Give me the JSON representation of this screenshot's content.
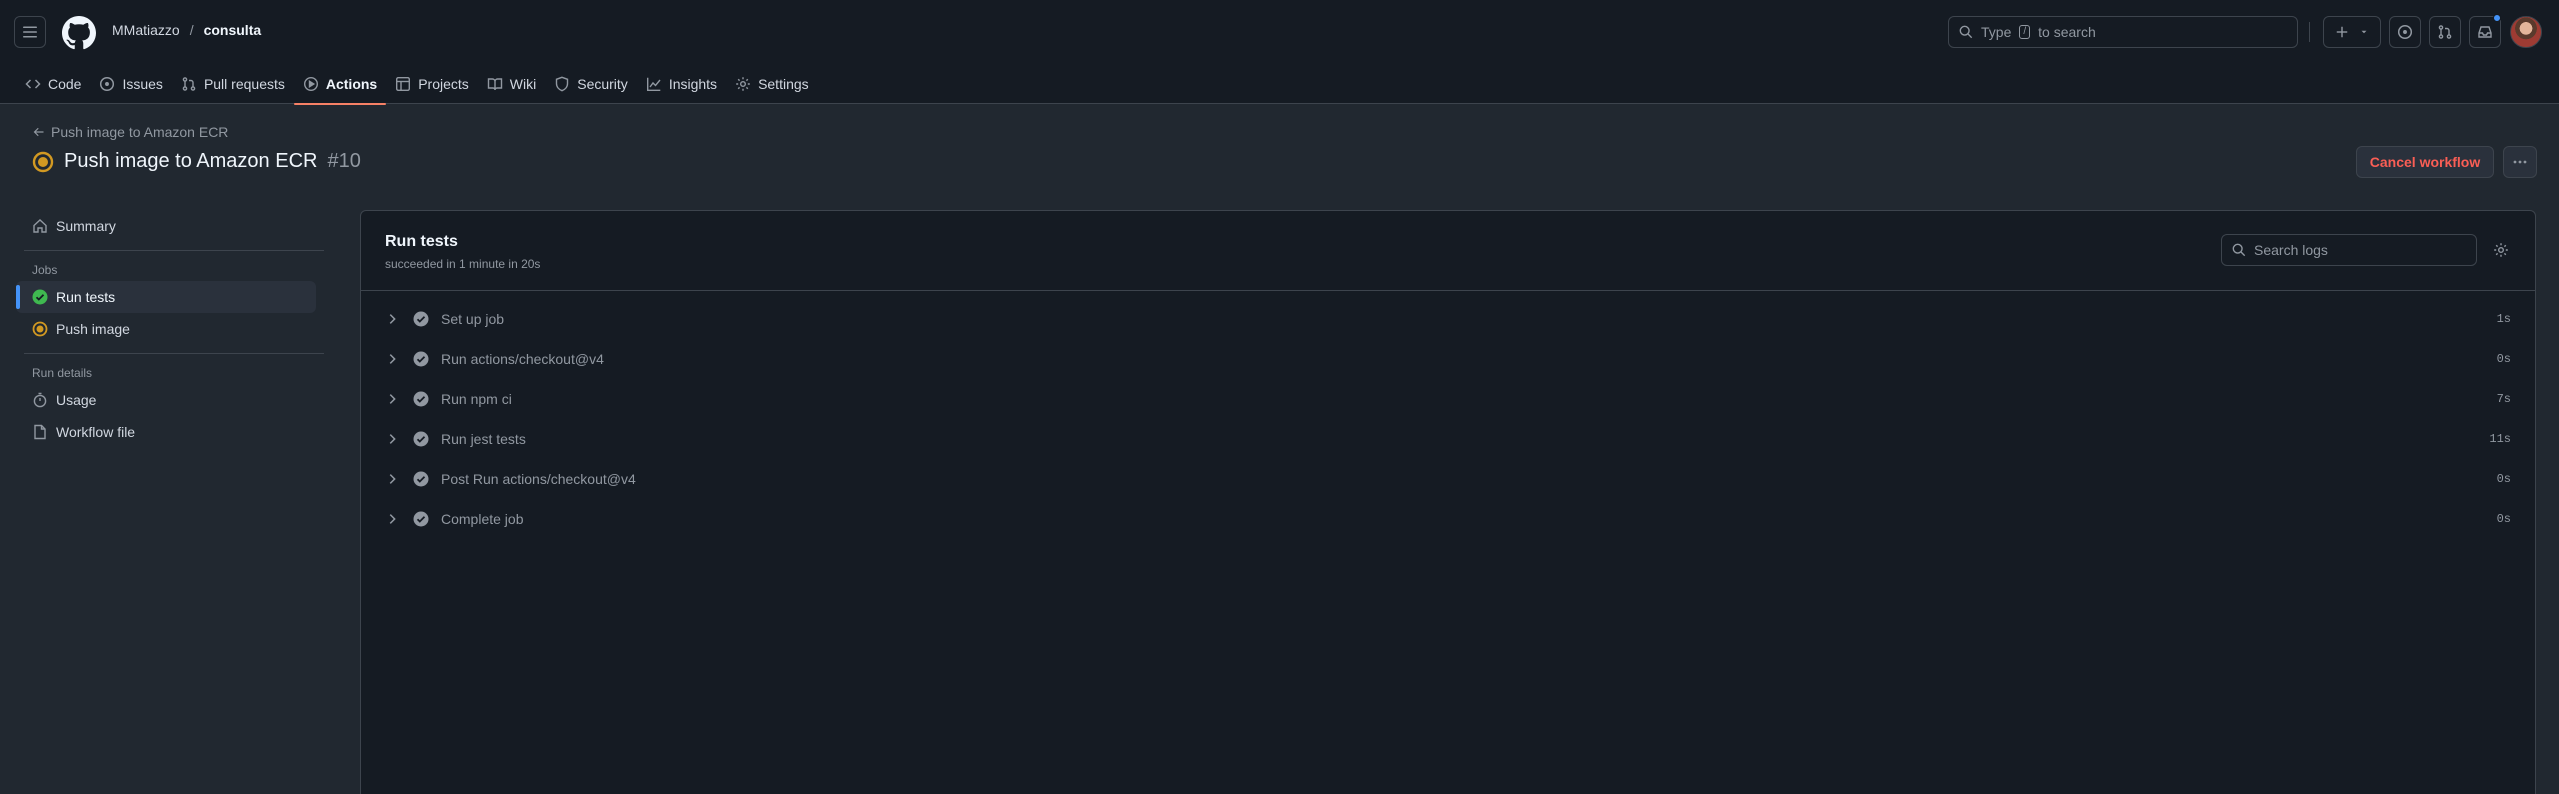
{
  "header": {
    "owner": "MMatiazzo",
    "separator": "/",
    "repo": "consulta",
    "search_prefix": "Type",
    "search_key": "/",
    "search_suffix": "to search"
  },
  "tabs": [
    {
      "label": "Code",
      "icon": "code-icon"
    },
    {
      "label": "Issues",
      "icon": "issue-opened-icon"
    },
    {
      "label": "Pull requests",
      "icon": "git-pull-request-icon"
    },
    {
      "label": "Actions",
      "icon": "play-icon",
      "active": true
    },
    {
      "label": "Projects",
      "icon": "table-icon"
    },
    {
      "label": "Wiki",
      "icon": "book-icon"
    },
    {
      "label": "Security",
      "icon": "shield-icon"
    },
    {
      "label": "Insights",
      "icon": "graph-icon"
    },
    {
      "label": "Settings",
      "icon": "gear-icon"
    }
  ],
  "run": {
    "back_label": "Push image to Amazon ECR",
    "title": "Push image to Amazon ECR",
    "number": "#10",
    "status_color": "#d29922",
    "cancel_label": "Cancel workflow"
  },
  "sidebar": {
    "summary_label": "Summary",
    "jobs_heading": "Jobs",
    "jobs": [
      {
        "label": "Run tests",
        "status": "success",
        "active": true
      },
      {
        "label": "Push image",
        "status": "in-progress"
      }
    ],
    "run_details_heading": "Run details",
    "details": [
      {
        "label": "Usage",
        "icon": "stopwatch-icon"
      },
      {
        "label": "Workflow file",
        "icon": "file-icon"
      }
    ]
  },
  "job": {
    "title": "Run tests",
    "subtitle": "succeeded in 1 minute in 20s",
    "search_placeholder": "Search logs",
    "steps": [
      {
        "name": "Set up job",
        "duration": "1s"
      },
      {
        "name": "Run actions/checkout@v4",
        "duration": "0s"
      },
      {
        "name": "Run npm ci",
        "duration": "7s"
      },
      {
        "name": "Run jest tests",
        "duration": "11s"
      },
      {
        "name": "Post Run actions/checkout@v4",
        "duration": "0s"
      },
      {
        "name": "Complete job",
        "duration": "0s"
      }
    ]
  },
  "colors": {
    "success": "#3fb950",
    "in_progress": "#d29922",
    "accent": "#f78166",
    "danger": "#fa5e55"
  }
}
